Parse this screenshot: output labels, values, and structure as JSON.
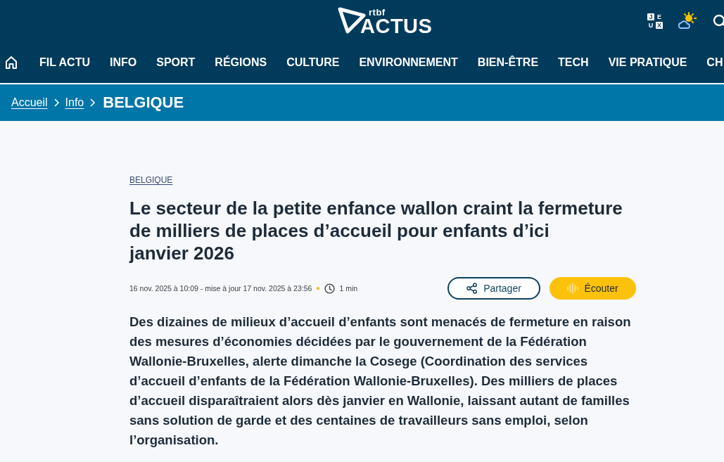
{
  "header": {
    "logo": {
      "small": "rtbf",
      "large": "ACTUS"
    },
    "games_tiles": [
      {
        "letter": "J",
        "filled": true
      },
      {
        "letter": "E",
        "filled": false
      },
      {
        "letter": "U",
        "filled": false
      },
      {
        "letter": "X",
        "filled": true
      }
    ]
  },
  "nav": {
    "items": [
      "FIL ACTU",
      "INFO",
      "SPORT",
      "RÉGIONS",
      "CULTURE",
      "ENVIRONNEMENT",
      "BIEN-ÊTRE",
      "TECH",
      "VIE PRATIQUE",
      "CH"
    ]
  },
  "breadcrumb": [
    {
      "label": "Accueil",
      "kind": "link"
    },
    {
      "label": "Info",
      "kind": "link"
    },
    {
      "label": "BELGIQUE",
      "kind": "current"
    }
  ],
  "article": {
    "category": "BELGIQUE",
    "title": "Le secteur de la petite enfance wallon craint la fermeture de milliers de places d’accueil pour enfants d’ici janvier 2026",
    "meta": {
      "dates": "16 nov. 2025 à 10:09 - mise à jour 17 nov. 2025 à 23:56",
      "reading_time": "1 min"
    },
    "actions": [
      {
        "label": "Partager",
        "kind": "share"
      },
      {
        "label": "Écouter",
        "kind": "listen"
      }
    ],
    "lead": "Des dizaines de milieux d’accueil d’enfants sont menacés de fermeture en raison des mesures d’économies décidées par le gouvernement de la Fédération Wallonie-Bruxelles, alerte dimanche la Cosege (Coordination des services d’accueil d’enfants de la Fédération Wallonie-Bruxelles). Des milliers de places d’accueil disparaîtraient alors dès janvier en Wallonie, laissant autant de familles sans solution de garde et des centaines de travailleurs sans emploi, selon l’organisation."
  }
}
